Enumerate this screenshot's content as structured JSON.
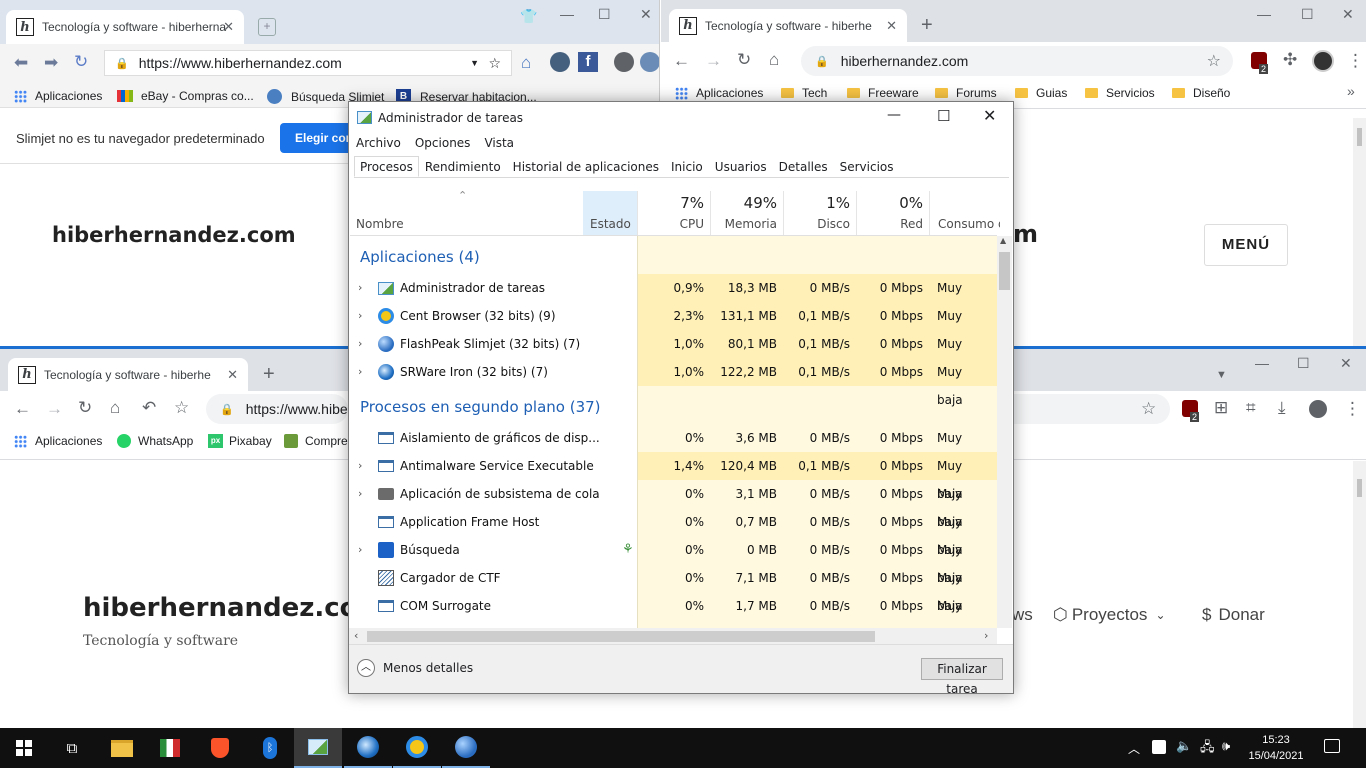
{
  "window_a": {
    "tab_title": "Tecnología y software - hiberherna",
    "url": "https://www.hiberhernandez.com",
    "bookmarks": [
      "Aplicaciones",
      "eBay - Compras co...",
      "Búsqueda Slimjet",
      "Reservar habitacion..."
    ],
    "infobar_text": "Slimjet no es tu navegador predeterminado",
    "infobar_button": "Elegir com",
    "site_title": "hiberhernandez.com"
  },
  "window_b": {
    "tab_title": "Tecnología y software - hiberhe",
    "url": "hiberhernandez.com",
    "bookmarks": [
      "Aplicaciones",
      "Tech",
      "Freeware",
      "Forums",
      "Guias",
      "Servicios",
      "Diseño"
    ],
    "site_title_fragment": "m",
    "menu_button": "MENÚ",
    "ext_badge": "2"
  },
  "window_c": {
    "tab_title": "Tecnología y software - hiberhe",
    "url": "https://www.hiber",
    "bookmarks": [
      "Aplicaciones",
      "WhatsApp",
      "Pixabay",
      "Compre"
    ],
    "site_title": "hiberhernandez.co",
    "site_subtitle": "Tecnología y software",
    "nav_fragment": "ws",
    "nav_projects": "Proyectos",
    "nav_donate": "Donar",
    "ext_badge": "2"
  },
  "taskmgr": {
    "title": "Administrador de tareas",
    "menu": [
      "Archivo",
      "Opciones",
      "Vista"
    ],
    "tabs": [
      "Procesos",
      "Rendimiento",
      "Historial de aplicaciones",
      "Inicio",
      "Usuarios",
      "Detalles",
      "Servicios"
    ],
    "columns": {
      "name": "Nombre",
      "status": "Estado",
      "cpu_pct": "7%",
      "cpu": "CPU",
      "mem_pct": "49%",
      "mem": "Memoria",
      "disk_pct": "1%",
      "disk": "Disco",
      "net_pct": "0%",
      "net": "Red",
      "power": "Consumo de ..."
    },
    "group_apps": "Aplicaciones (4)",
    "apps": [
      {
        "name": "Administrador de tareas",
        "cpu": "0,9%",
        "mem": "18,3 MB",
        "disk": "0 MB/s",
        "net": "0 Mbps",
        "power": "Muy baja",
        "icon": "taskmgr-icon"
      },
      {
        "name": "Cent Browser (32 bits) (9)",
        "cpu": "2,3%",
        "mem": "131,1 MB",
        "disk": "0,1 MB/s",
        "net": "0 Mbps",
        "power": "Muy baja",
        "icon": "cent-browser-icon"
      },
      {
        "name": "FlashPeak Slimjet (32 bits) (7)",
        "cpu": "1,0%",
        "mem": "80,1 MB",
        "disk": "0,1 MB/s",
        "net": "0 Mbps",
        "power": "Muy baja",
        "icon": "slimjet-icon"
      },
      {
        "name": "SRWare Iron (32 bits) (7)",
        "cpu": "1,0%",
        "mem": "122,2 MB",
        "disk": "0,1 MB/s",
        "net": "0 Mbps",
        "power": "Muy baja",
        "icon": "iron-icon"
      }
    ],
    "group_bg": "Procesos en segundo plano (37)",
    "background": [
      {
        "name": "Aislamiento de gráficos de disp...",
        "cpu": "0%",
        "mem": "3,6 MB",
        "disk": "0 MB/s",
        "net": "0 Mbps",
        "power": "Muy baja",
        "expand": false
      },
      {
        "name": "Antimalware Service Executable",
        "cpu": "1,4%",
        "mem": "120,4 MB",
        "disk": "0,1 MB/s",
        "net": "0 Mbps",
        "power": "Muy baja",
        "expand": true
      },
      {
        "name": "Aplicación de subsistema de cola",
        "cpu": "0%",
        "mem": "3,1 MB",
        "disk": "0 MB/s",
        "net": "0 Mbps",
        "power": "Muy baja",
        "expand": true
      },
      {
        "name": "Application Frame Host",
        "cpu": "0%",
        "mem": "0,7 MB",
        "disk": "0 MB/s",
        "net": "0 Mbps",
        "power": "Muy baja",
        "expand": false
      },
      {
        "name": "Búsqueda",
        "cpu": "0%",
        "mem": "0 MB",
        "disk": "0 MB/s",
        "net": "0 Mbps",
        "power": "Muy baja",
        "expand": true
      },
      {
        "name": "Cargador de CTF",
        "cpu": "0%",
        "mem": "7,1 MB",
        "disk": "0 MB/s",
        "net": "0 Mbps",
        "power": "Muy baja",
        "expand": false
      },
      {
        "name": "COM Surrogate",
        "cpu": "0%",
        "mem": "1,7 MB",
        "disk": "0 MB/s",
        "net": "0 Mbps",
        "power": "Muy baja",
        "expand": false
      }
    ],
    "fewer_details": "Menos detalles",
    "end_task": "Finalizar tarea"
  },
  "taskbar": {
    "time": "15:23",
    "date": "15/04/2021"
  }
}
